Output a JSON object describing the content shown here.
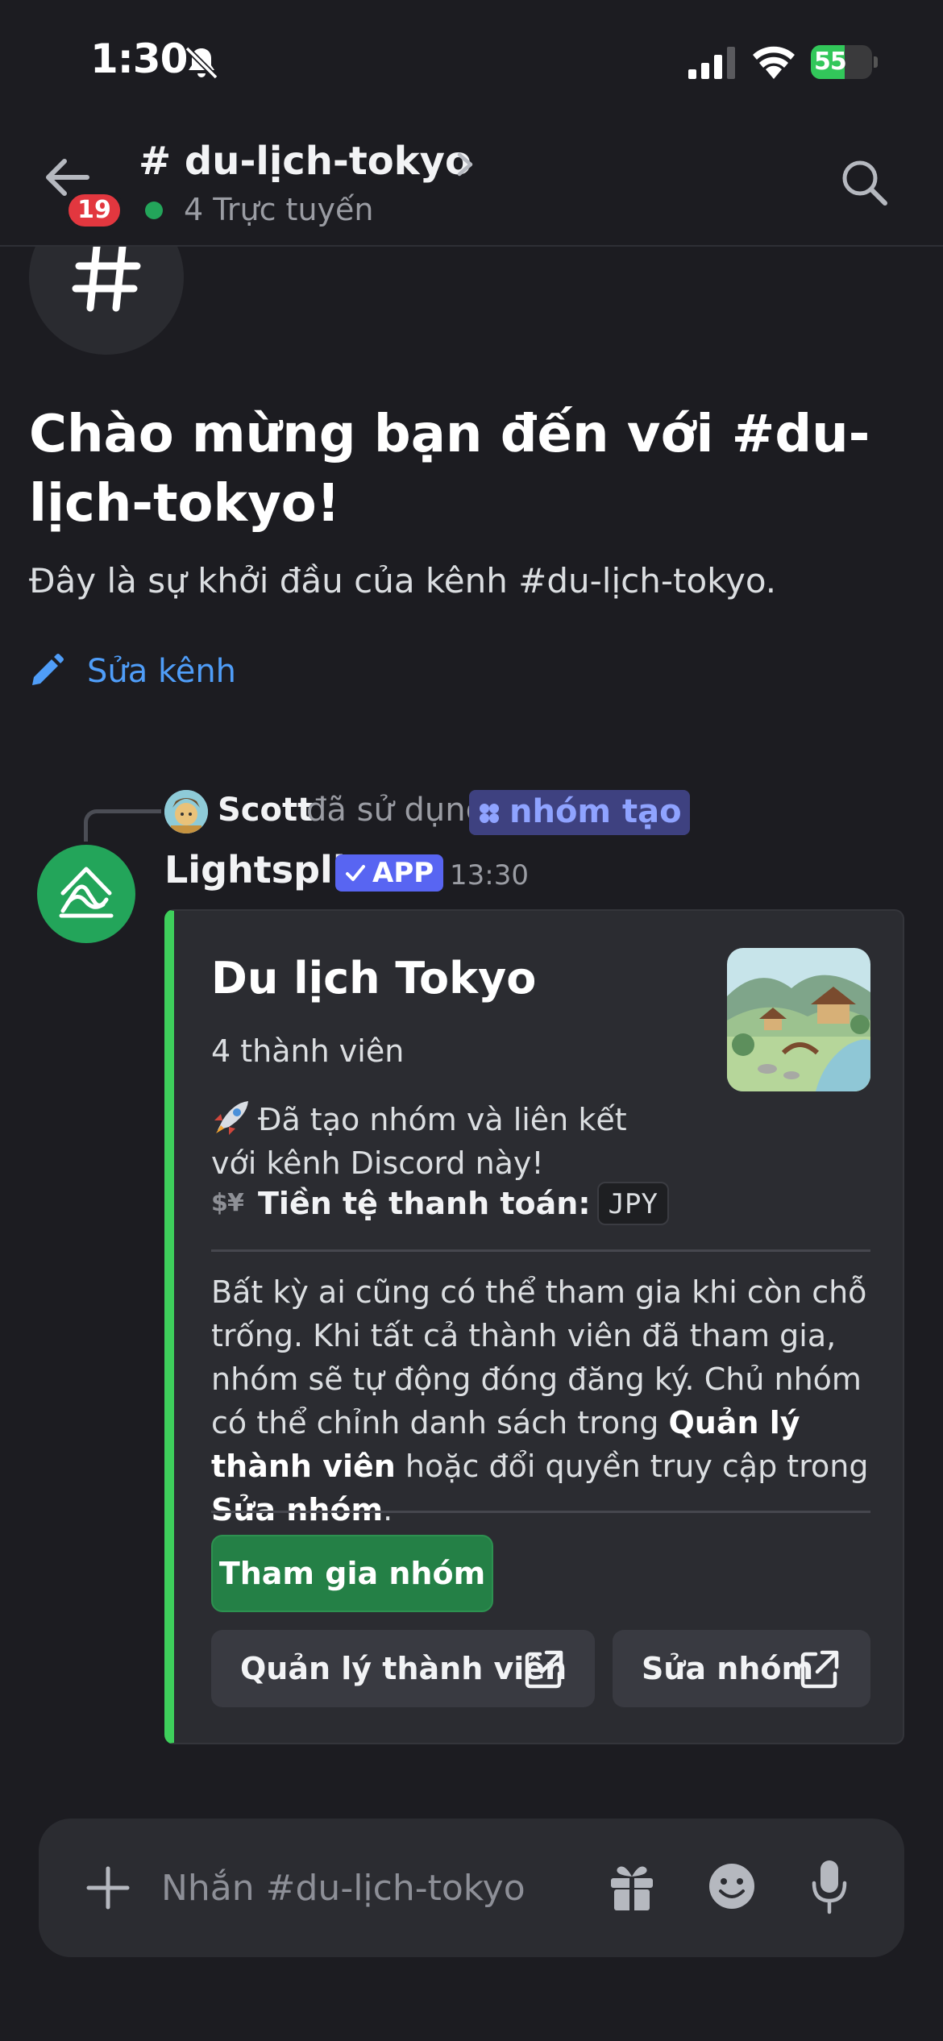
{
  "status_bar": {
    "time": "1:30",
    "battery_level": "55",
    "battery_fraction": 0.55
  },
  "header": {
    "channel_title": "# du-lịch-tokyo",
    "unread_badge": "19",
    "online_text": "4 Trực tuyến"
  },
  "intro": {
    "title": "Chào mừng bạn đến với #du-lịch-tokyo!",
    "subtitle": "Đây là sự khởi đầu của kênh #du-lịch-tokyo.",
    "edit_channel_label": "Sửa kênh"
  },
  "reply": {
    "user_name": "Scott",
    "used_text": "đã sử dụng",
    "command_name": "nhóm tạo"
  },
  "message": {
    "author": "Lightsplit",
    "app_tag": "APP",
    "time": "13:30"
  },
  "embed": {
    "title": "Du lịch Tokyo",
    "members": "4 thành viên",
    "created_text": "Đã tạo nhóm và liên kết với kênh Discord này!",
    "currency_label": "Tiền tệ thanh toán:",
    "currency_value": "JPY",
    "desc_part1": "Bất kỳ ai cũng có thể tham gia khi còn chỗ trống. Khi tất cả thành viên đã tham gia, nhóm sẽ tự động đóng đăng ký. Chủ nhóm có thể chỉnh danh sách trong ",
    "desc_bold1": "Quản lý thành viên",
    "desc_part2": " hoặc đổi quyền truy cập trong ",
    "desc_bold2": "Sửa nhóm",
    "desc_part3": ".",
    "join_button": "Tham gia nhóm",
    "manage_button": "Quản lý thành viên",
    "edit_button": "Sửa nhóm"
  },
  "composer": {
    "placeholder": "Nhắn #du-lịch-tokyo"
  },
  "icons": {
    "bell_off": "bell-slash-icon",
    "back": "arrow-left-icon",
    "search": "magnifier-icon",
    "channel": "hash-icon",
    "edit": "pencil-icon",
    "plus": "plus-icon",
    "gift": "gift-icon",
    "emoji": "smiley-icon",
    "mic": "microphone-icon",
    "external": "external-link-icon"
  },
  "colors": {
    "background": "#1c1c21",
    "accent_green": "#23a55a",
    "embed_bar": "#3ecf5b",
    "link_blue": "#4f9df8",
    "badge_red": "#e2373f",
    "blurple": "#5865f2"
  }
}
